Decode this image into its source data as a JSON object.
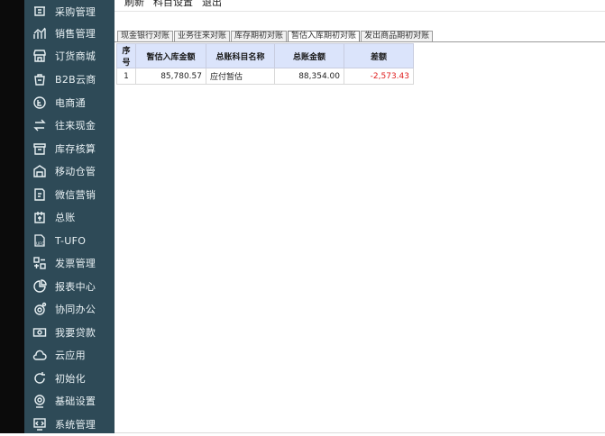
{
  "menu": {
    "refresh": "刷新",
    "account_settings": "科目设置",
    "exit": "退出"
  },
  "sidebar": {
    "items": [
      {
        "label": "采购管理",
        "icon": "purchase-icon"
      },
      {
        "label": "销售管理",
        "icon": "sales-chart-icon"
      },
      {
        "label": "订货商城",
        "icon": "store-icon"
      },
      {
        "label": "B2B云商",
        "icon": "b2b-bag-icon"
      },
      {
        "label": "电商通",
        "icon": "ecommerce-icon"
      },
      {
        "label": "往来现金",
        "icon": "exchange-icon"
      },
      {
        "label": "库存核算",
        "icon": "inventory-icon"
      },
      {
        "label": "移动仓管",
        "icon": "mobile-warehouse-icon"
      },
      {
        "label": "微信营销",
        "icon": "wechat-marketing-icon"
      },
      {
        "label": "总账",
        "icon": "ledger-icon"
      },
      {
        "label": "T-UFO",
        "icon": "ufo-icon"
      },
      {
        "label": "发票管理",
        "icon": "invoice-icon"
      },
      {
        "label": "报表中心",
        "icon": "report-pie-icon"
      },
      {
        "label": "协同办公",
        "icon": "collaboration-icon"
      },
      {
        "label": "我要贷款",
        "icon": "loan-icon"
      },
      {
        "label": "云应用",
        "icon": "cloud-icon"
      },
      {
        "label": "初始化",
        "icon": "init-refresh-icon"
      },
      {
        "label": "基础设置",
        "icon": "settings-icon"
      },
      {
        "label": "系统管理",
        "icon": "system-icon"
      }
    ]
  },
  "tabs": [
    {
      "label": "现金银行对账"
    },
    {
      "label": "业务往来对账"
    },
    {
      "label": "库存期初对账"
    },
    {
      "label": "暂估入库期初对账"
    },
    {
      "label": "发出商品期初对账"
    }
  ],
  "active_tab": 3,
  "table": {
    "headers": {
      "seq": "序号",
      "est_amount": "暂估入库金额",
      "gl_account": "总账科目名称",
      "gl_amount": "总账金额",
      "diff": "差额"
    },
    "rows": [
      {
        "seq": "1",
        "est_amount": "85,780.57",
        "gl_account": "应付暂估",
        "gl_amount": "88,354.00",
        "diff": "-2,573.43"
      }
    ]
  },
  "colors": {
    "sidebar_bg": "#2e4a57",
    "header_bg": "#dbe4fb",
    "negative": "#e02020"
  }
}
